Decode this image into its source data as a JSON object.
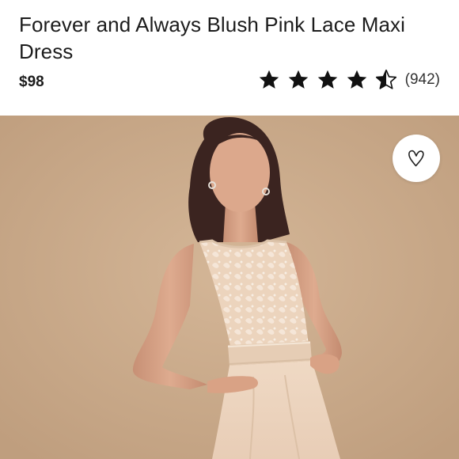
{
  "product": {
    "title": "Forever and Always Blush Pink Lace Maxi Dress",
    "price": "$98",
    "rating": {
      "stars": 4.5,
      "max_stars": 5,
      "review_count": "(942)"
    }
  },
  "image": {
    "description_icon": "model-photo",
    "background_color": "#c8a888"
  },
  "favorite": {
    "icon": "heart-outline-icon"
  }
}
